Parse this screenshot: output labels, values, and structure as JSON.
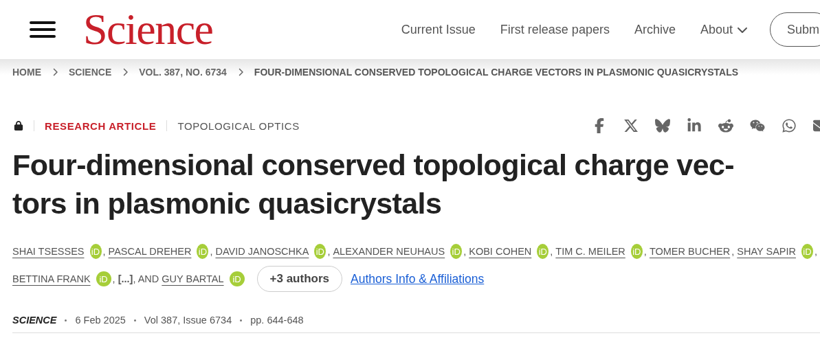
{
  "header": {
    "logo": "Science",
    "nav": [
      {
        "label": "Current Issue",
        "kind": "link"
      },
      {
        "label": "First release papers",
        "kind": "link"
      },
      {
        "label": "Archive",
        "kind": "link"
      },
      {
        "label": "About",
        "kind": "dropdown"
      }
    ],
    "submit": "Subm"
  },
  "breadcrumb": [
    "HOME",
    "SCIENCE",
    "VOL. 387, NO. 6734",
    "FOUR-DIMENSIONAL CONSERVED TOPOLOGICAL CHARGE VECTORS IN PLASMONIC QUASICRYSTALS"
  ],
  "meta": {
    "locked": true,
    "article_type": "RESEARCH ARTICLE",
    "topic": "TOPOLOGICAL OPTICS"
  },
  "share_icons": [
    {
      "kind": "facebook"
    },
    {
      "kind": "x"
    },
    {
      "kind": "bluesky"
    },
    {
      "kind": "linkedin"
    },
    {
      "kind": "reddit"
    },
    {
      "kind": "wechat"
    },
    {
      "kind": "whatsapp"
    },
    {
      "kind": "email"
    }
  ],
  "title_lines": [
    "Four-dimensional conserved topological charge vec-",
    "tors in plasmonic quasicrystals"
  ],
  "author_lines": [
    [
      {
        "name": "SHAI TSESSES",
        "orcid": "iD",
        "after": ","
      },
      {
        "name": "PASCAL DREHER",
        "orcid": "iD",
        "after": ","
      },
      {
        "name": "DAVID JANOSCHKA",
        "orcid": "iD",
        "after": ","
      },
      {
        "name": "ALEXANDER NEUHAUS",
        "orcid": "iD",
        "after": ","
      },
      {
        "name": "KOBI COHEN",
        "orcid": "iD",
        "after": ","
      },
      {
        "name": "TIM C. MEILER",
        "orcid": "iD",
        "after": ","
      },
      {
        "name": "TOMER BUCHER",
        "after": ","
      },
      {
        "name": "SHAY SAPIR",
        "orcid": "iD",
        "after": ","
      }
    ],
    [
      {
        "name": "BETTINA FRANK",
        "orcid": "iD",
        "after": ", **[...]**, AND"
      },
      {
        "name": "GUY BARTAL",
        "orcid": "iD"
      }
    ]
  ],
  "more_authors": "+3 authors",
  "affiliations_link": "Authors Info & Affiliations",
  "citation": {
    "journal": "SCIENCE",
    "date": "6 Feb 2025",
    "volume": "Vol 387, Issue 6734",
    "pages": "pp. 644-648"
  }
}
